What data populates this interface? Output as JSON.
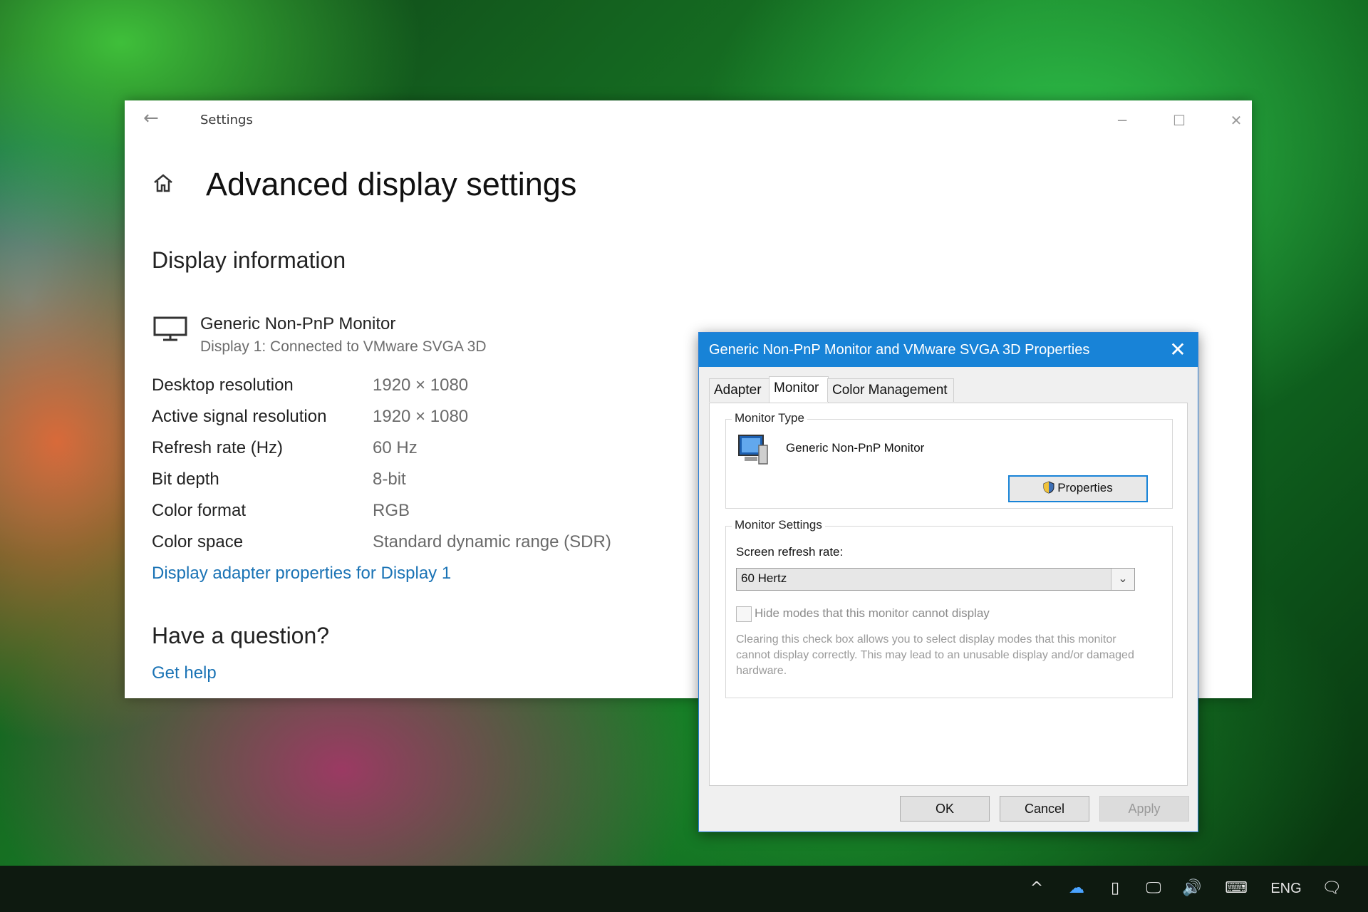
{
  "settings_window": {
    "title": "Settings",
    "page_title": "Advanced display settings",
    "section_title": "Display information",
    "monitor": {
      "name": "Generic Non-PnP Monitor",
      "subtitle": "Display 1: Connected to VMware SVGA 3D"
    },
    "info_rows": [
      {
        "label": "Desktop resolution",
        "value": "1920 × 1080"
      },
      {
        "label": "Active signal resolution",
        "value": "1920 × 1080"
      },
      {
        "label": "Refresh rate (Hz)",
        "value": "60 Hz"
      },
      {
        "label": "Bit depth",
        "value": "8-bit"
      },
      {
        "label": "Color format",
        "value": "RGB"
      },
      {
        "label": "Color space",
        "value": "Standard dynamic range (SDR)"
      }
    ],
    "adapter_link": "Display adapter properties for Display 1",
    "question_title": "Have a question?",
    "help_link": "Get help",
    "icons": {
      "back": "back-arrow-icon",
      "minimize": "minimize-icon",
      "maximize": "maximize-icon",
      "close": "close-icon",
      "home": "home-icon",
      "monitor": "monitor-icon"
    }
  },
  "dialog": {
    "title": "Generic Non-PnP Monitor and VMware SVGA 3D Properties",
    "tabs": [
      "Adapter",
      "Monitor",
      "Color Management"
    ],
    "active_tab": "Monitor",
    "monitor_type": {
      "legend": "Monitor Type",
      "name": "Generic Non-PnP Monitor",
      "properties_button": "Properties"
    },
    "monitor_settings": {
      "legend": "Monitor Settings",
      "refresh_label": "Screen refresh rate:",
      "refresh_value": "60 Hertz",
      "hide_modes_label": "Hide modes that this monitor cannot display",
      "hide_modes_checked": false,
      "help_text": "Clearing this check box allows you to select display modes that this monitor cannot display correctly. This may lead to an unusable display and/or damaged hardware."
    },
    "buttons": {
      "ok": "OK",
      "cancel": "Cancel",
      "apply": "Apply"
    }
  },
  "taskbar": {
    "language": "ENG",
    "tray_icons": [
      "chevron-up-icon",
      "onedrive-icon",
      "usb-icon",
      "network-icon",
      "volume-icon",
      "keyboard-icon",
      "notification-icon"
    ]
  },
  "colors": {
    "accent": "#1883d7",
    "link": "#1a73b5",
    "taskbar": "#0e1a10"
  }
}
